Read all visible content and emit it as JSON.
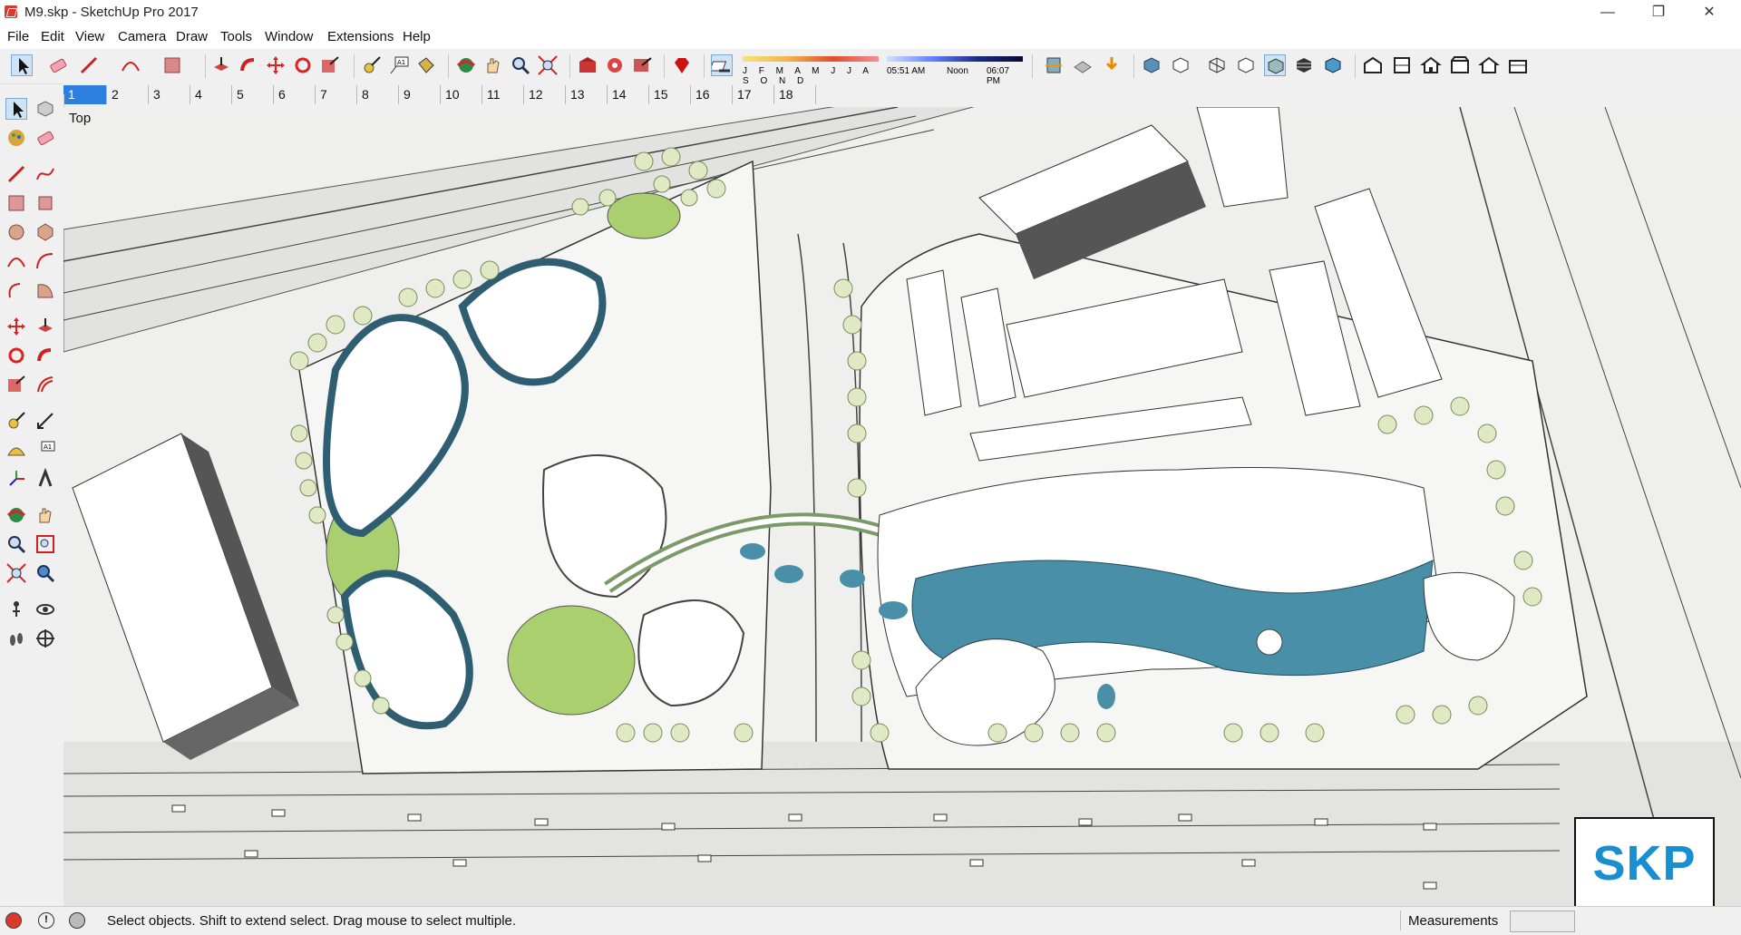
{
  "window": {
    "title": "M9.skp - SketchUp Pro 2017",
    "minimize_icon": "minimize-icon",
    "restore_icon": "restore-icon",
    "close_icon": "close-icon"
  },
  "menu": [
    "File",
    "Edit",
    "View",
    "Camera",
    "Draw",
    "Tools",
    "Window",
    "Extensions",
    "Help"
  ],
  "shadows": {
    "months": "J F M A M J J A S O N D",
    "time_start": "05:51 AM",
    "time_mid": "Noon",
    "time_end": "06:07 PM"
  },
  "scenes": [
    "1",
    "2",
    "3",
    "4",
    "5",
    "6",
    "7",
    "8",
    "9",
    "10",
    "11",
    "12",
    "13",
    "14",
    "15",
    "16",
    "17",
    "18"
  ],
  "active_scene": "1",
  "viewport": {
    "view_label": "Top"
  },
  "watermark": {
    "text": "SKP"
  },
  "status": {
    "message": "Select objects. Shift to extend select. Drag mouse to select multiple.",
    "measurements_label": "Measurements"
  },
  "colors": {
    "glass": "#4a8fa8",
    "tree": "#d8e6b2",
    "lawn": "#a9cf6f",
    "accent": "#2d7fe0"
  }
}
